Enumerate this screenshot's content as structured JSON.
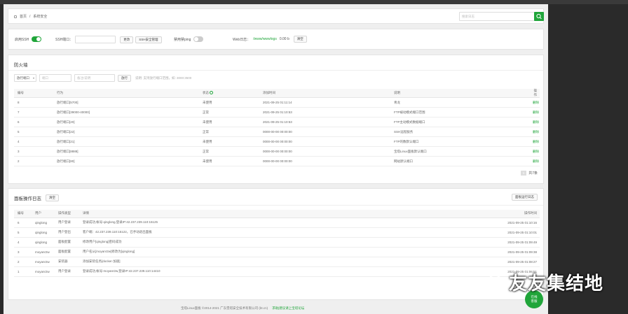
{
  "header": {
    "breadcrumb": [
      "首页",
      "/",
      "系统安全"
    ],
    "search_placeholder": "搜索日志"
  },
  "toolbar": {
    "ssh_label": "启用SSH",
    "ssh_port_label": "SSH端口：",
    "ssh_port_value": "",
    "change_btn": "更改",
    "ssh_manage_btn": "SSH安全管理",
    "ping_label": "禁用禁ping",
    "weblog_label": "Web日志：",
    "weblog_path": "/www/wwwlogs",
    "weblog_size": "0.00 b",
    "clear_btn": "清空"
  },
  "firewall": {
    "title": "防火墙",
    "select_value": "放行端口",
    "port_placeholder": "端口",
    "remark_placeholder": "备注/说明",
    "release_btn": "放行",
    "hint": "说明: 支持放行端口范围，如: 3000:3500",
    "columns": [
      "编号",
      "行为",
      "状态",
      "添加时间",
      "说明",
      "操作"
    ],
    "rows": [
      {
        "id": "8",
        "action": "放行端口[5700]",
        "status": "未使用",
        "time": "2021-09-25 01:11:14",
        "note": "青龙",
        "op": "删除"
      },
      {
        "id": "7",
        "action": "放行端口[39000-40000]",
        "status": "正常",
        "time": "2021-09-25 01:10:53",
        "note": "FTP被动模式端口范围",
        "op": "删除"
      },
      {
        "id": "6",
        "action": "放行端口[20]",
        "status": "未使用",
        "time": "2021-09-25 01:10:53",
        "note": "FTP主动模式数据端口",
        "op": "删除"
      },
      {
        "id": "5",
        "action": "放行端口[22]",
        "status": "正常",
        "time": "0000-00-00 00:00:00",
        "note": "SSH远程服务",
        "op": "删除"
      },
      {
        "id": "4",
        "action": "放行端口[21]",
        "status": "未使用",
        "time": "0000-00-00 00:00:00",
        "note": "FTP的数默认端口",
        "op": "删除"
      },
      {
        "id": "3",
        "action": "放行端口[8888]",
        "status": "正常",
        "time": "0000-00-00 00:00:00",
        "note": "宝塔Linux面板默认端口",
        "op": "删除"
      },
      {
        "id": "2",
        "action": "放行端口[80]",
        "status": "未使用",
        "time": "0000-00-00 00:00:00",
        "note": "网站默认端口",
        "op": "删除"
      }
    ],
    "page": "1",
    "total": "共7条"
  },
  "logs": {
    "title": "面板操作日志",
    "clear_btn": "清空",
    "running_log_btn": "面板运行日志",
    "columns": [
      "编号",
      "用户",
      "操作类型",
      "详情",
      "操作时间"
    ],
    "rows": [
      {
        "id": "6",
        "user": "qinglong",
        "type": "用户登录",
        "detail": "登录成功,帐号:qinglong,登录IP:42.237.239.110:15125",
        "time": "2021-09-25 01:10:16"
      },
      {
        "id": "5",
        "user": "qinglong",
        "type": "用户登出",
        "detail": "客户端：42.237.239.110:15122，已手动退出面板",
        "time": "2021-09-25 01:10:01"
      },
      {
        "id": "4",
        "user": "qinglong",
        "type": "面板配置",
        "detail": "修改用户[qinglong]密码成功",
        "time": "2021-09-25 01:09:49"
      },
      {
        "id": "3",
        "user": "moyanr2w",
        "type": "面板配置",
        "detail": "用户名从[moyanr2w]修改为[qinglong]",
        "time": "2021-09-25 01:09:38"
      },
      {
        "id": "2",
        "user": "moyanr2w",
        "type": "安装器",
        "detail": "添加安装任务[docker-加速]",
        "time": "2021-09-25 01:08:27"
      },
      {
        "id": "1",
        "user": "moyanr2w",
        "type": "用户登录",
        "detail": "登录成功,帐号:moyanr2w,登录IP:42.237.239.110:14410",
        "time": "2021-09-25 01:06:51"
      }
    ]
  },
  "footer": {
    "copyright": "宝塔Linux面板 ©2014-2021 广东堡塔安全技术有限公司 (bt.cn)",
    "links": "求助|建议请上宝塔论坛"
  },
  "float_btn": {
    "line1": "在线",
    "line2": "客服"
  },
  "watermark": "友友集结地",
  "colors": {
    "accent": "#20a53a",
    "background": "#efefef"
  }
}
